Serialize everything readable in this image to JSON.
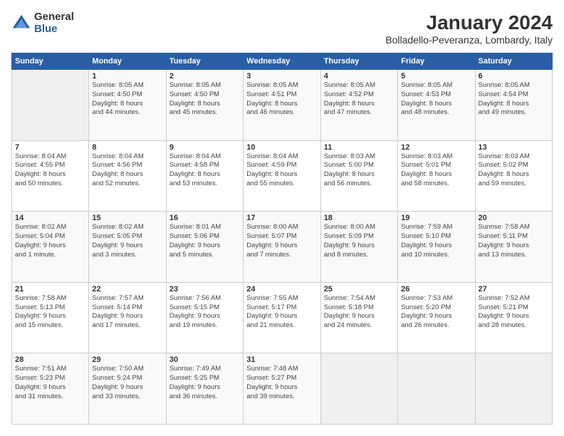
{
  "logo": {
    "general": "General",
    "blue": "Blue"
  },
  "header": {
    "title": "January 2024",
    "subtitle": "Bolladello-Peveranza, Lombardy, Italy"
  },
  "weekdays": [
    "Sunday",
    "Monday",
    "Tuesday",
    "Wednesday",
    "Thursday",
    "Friday",
    "Saturday"
  ],
  "weeks": [
    [
      {
        "day": "",
        "info": ""
      },
      {
        "day": "1",
        "info": "Sunrise: 8:05 AM\nSunset: 4:50 PM\nDaylight: 8 hours\nand 44 minutes."
      },
      {
        "day": "2",
        "info": "Sunrise: 8:05 AM\nSunset: 4:50 PM\nDaylight: 8 hours\nand 45 minutes."
      },
      {
        "day": "3",
        "info": "Sunrise: 8:05 AM\nSunset: 4:51 PM\nDaylight: 8 hours\nand 46 minutes."
      },
      {
        "day": "4",
        "info": "Sunrise: 8:05 AM\nSunset: 4:52 PM\nDaylight: 8 hours\nand 47 minutes."
      },
      {
        "day": "5",
        "info": "Sunrise: 8:05 AM\nSunset: 4:53 PM\nDaylight: 8 hours\nand 48 minutes."
      },
      {
        "day": "6",
        "info": "Sunrise: 8:05 AM\nSunset: 4:54 PM\nDaylight: 8 hours\nand 49 minutes."
      }
    ],
    [
      {
        "day": "7",
        "info": "Sunrise: 8:04 AM\nSunset: 4:55 PM\nDaylight: 8 hours\nand 50 minutes."
      },
      {
        "day": "8",
        "info": "Sunrise: 8:04 AM\nSunset: 4:56 PM\nDaylight: 8 hours\nand 52 minutes."
      },
      {
        "day": "9",
        "info": "Sunrise: 8:04 AM\nSunset: 4:58 PM\nDaylight: 8 hours\nand 53 minutes."
      },
      {
        "day": "10",
        "info": "Sunrise: 8:04 AM\nSunset: 4:59 PM\nDaylight: 8 hours\nand 55 minutes."
      },
      {
        "day": "11",
        "info": "Sunrise: 8:03 AM\nSunset: 5:00 PM\nDaylight: 8 hours\nand 56 minutes."
      },
      {
        "day": "12",
        "info": "Sunrise: 8:03 AM\nSunset: 5:01 PM\nDaylight: 8 hours\nand 58 minutes."
      },
      {
        "day": "13",
        "info": "Sunrise: 8:03 AM\nSunset: 5:02 PM\nDaylight: 8 hours\nand 59 minutes."
      }
    ],
    [
      {
        "day": "14",
        "info": "Sunrise: 8:02 AM\nSunset: 5:04 PM\nDaylight: 9 hours\nand 1 minute."
      },
      {
        "day": "15",
        "info": "Sunrise: 8:02 AM\nSunset: 5:05 PM\nDaylight: 9 hours\nand 3 minutes."
      },
      {
        "day": "16",
        "info": "Sunrise: 8:01 AM\nSunset: 5:06 PM\nDaylight: 9 hours\nand 5 minutes."
      },
      {
        "day": "17",
        "info": "Sunrise: 8:00 AM\nSunset: 5:07 PM\nDaylight: 9 hours\nand 7 minutes."
      },
      {
        "day": "18",
        "info": "Sunrise: 8:00 AM\nSunset: 5:09 PM\nDaylight: 9 hours\nand 8 minutes."
      },
      {
        "day": "19",
        "info": "Sunrise: 7:59 AM\nSunset: 5:10 PM\nDaylight: 9 hours\nand 10 minutes."
      },
      {
        "day": "20",
        "info": "Sunrise: 7:58 AM\nSunset: 5:11 PM\nDaylight: 9 hours\nand 13 minutes."
      }
    ],
    [
      {
        "day": "21",
        "info": "Sunrise: 7:58 AM\nSunset: 5:13 PM\nDaylight: 9 hours\nand 15 minutes."
      },
      {
        "day": "22",
        "info": "Sunrise: 7:57 AM\nSunset: 5:14 PM\nDaylight: 9 hours\nand 17 minutes."
      },
      {
        "day": "23",
        "info": "Sunrise: 7:56 AM\nSunset: 5:15 PM\nDaylight: 9 hours\nand 19 minutes."
      },
      {
        "day": "24",
        "info": "Sunrise: 7:55 AM\nSunset: 5:17 PM\nDaylight: 9 hours\nand 21 minutes."
      },
      {
        "day": "25",
        "info": "Sunrise: 7:54 AM\nSunset: 5:18 PM\nDaylight: 9 hours\nand 24 minutes."
      },
      {
        "day": "26",
        "info": "Sunrise: 7:53 AM\nSunset: 5:20 PM\nDaylight: 9 hours\nand 26 minutes."
      },
      {
        "day": "27",
        "info": "Sunrise: 7:52 AM\nSunset: 5:21 PM\nDaylight: 9 hours\nand 28 minutes."
      }
    ],
    [
      {
        "day": "28",
        "info": "Sunrise: 7:51 AM\nSunset: 5:23 PM\nDaylight: 9 hours\nand 31 minutes."
      },
      {
        "day": "29",
        "info": "Sunrise: 7:50 AM\nSunset: 5:24 PM\nDaylight: 9 hours\nand 33 minutes."
      },
      {
        "day": "30",
        "info": "Sunrise: 7:49 AM\nSunset: 5:25 PM\nDaylight: 9 hours\nand 36 minutes."
      },
      {
        "day": "31",
        "info": "Sunrise: 7:48 AM\nSunset: 5:27 PM\nDaylight: 9 hours\nand 39 minutes."
      },
      {
        "day": "",
        "info": ""
      },
      {
        "day": "",
        "info": ""
      },
      {
        "day": "",
        "info": ""
      }
    ]
  ]
}
